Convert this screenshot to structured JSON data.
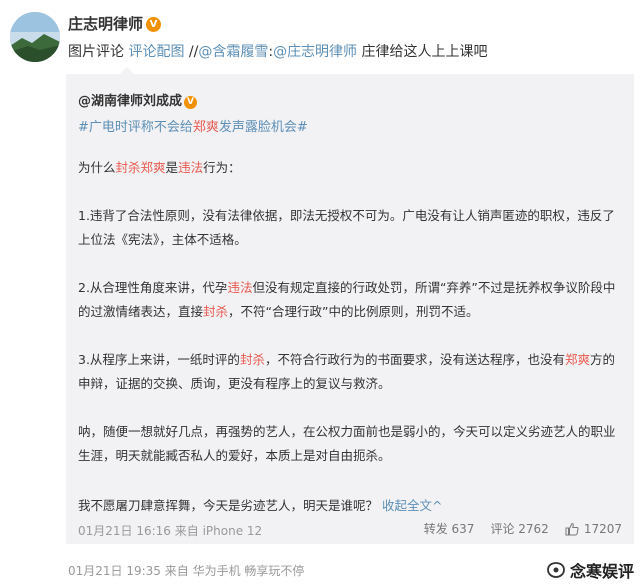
{
  "post": {
    "author": "庄志明律师",
    "verified_badge": "V",
    "comment_prefix": "图片评论",
    "comment_link": "评论配图",
    "comment_separator": "//",
    "mention_1": "@含霜履雪",
    "colon_1": ":",
    "mention_2": "@庄志明律师",
    "comment_text": " 庄律给这人上上课吧",
    "footer_meta": "01月21日 19:35  来自 华为手机 畅享玩不停"
  },
  "repost": {
    "author": "@湖南律师刘成成",
    "verified_badge": "V",
    "hashtag_a": "#广电时评称不会给",
    "hashtag_b": "郑爽",
    "hashtag_c": "发声露脸机会#",
    "p1_a": "为什么",
    "p1_b": "封杀",
    "p1_c": "郑爽",
    "p1_d": "是",
    "p1_e": "违法",
    "p1_f": "行为：",
    "p2": "1.违背了合法性原则，没有法律依据，即法无授权不可为。广电没有让人销声匿迹的职权，违反了上位法《宪法》，主体不适格。",
    "p3_a": "2.从合理性角度来讲，代孕",
    "p3_b": "违法",
    "p3_c": "但没有规定直接的行政处罚，所谓“弃养”不过是抚养权争议阶段中的过激情绪表达，直接",
    "p3_d": "封杀",
    "p3_e": "，不符“合理行政”中的比例原则，刑罚不适。",
    "p4_a": "3.从程序上来讲，一纸时评的",
    "p4_b": "封杀",
    "p4_c": "，不符合行政行为的书面要求，没有送达程序，也没有",
    "p4_d": "郑爽",
    "p4_e": "方的申辩，证据的交换、质询，更没有程序上的复议与救济。",
    "p5": "呐，随便一想就好几点，再强势的艺人，在公权力面前也是弱小的，今天可以定义劣迹艺人的职业生涯，明天就能臧否私人的爱好，本质上是对自由扼杀。",
    "p6_a": "我不愿屠刀肆意挥舞，今天是劣迹艺人，明天是谁呢？",
    "p6_b": "收起全文",
    "p6_c": "^",
    "meta": "01月21日 16:16 来自 iPhone 12",
    "repost_label": "转发 637",
    "comment_label": "评论 2762",
    "like_count": "17207"
  },
  "watermark": {
    "text": "念寒娱评"
  },
  "colors": {
    "link_orange": "#eb7350",
    "link_blue": "#5d8fb6",
    "highlight_red": "#e85a50",
    "repost_bg": "#f2f2f5"
  }
}
